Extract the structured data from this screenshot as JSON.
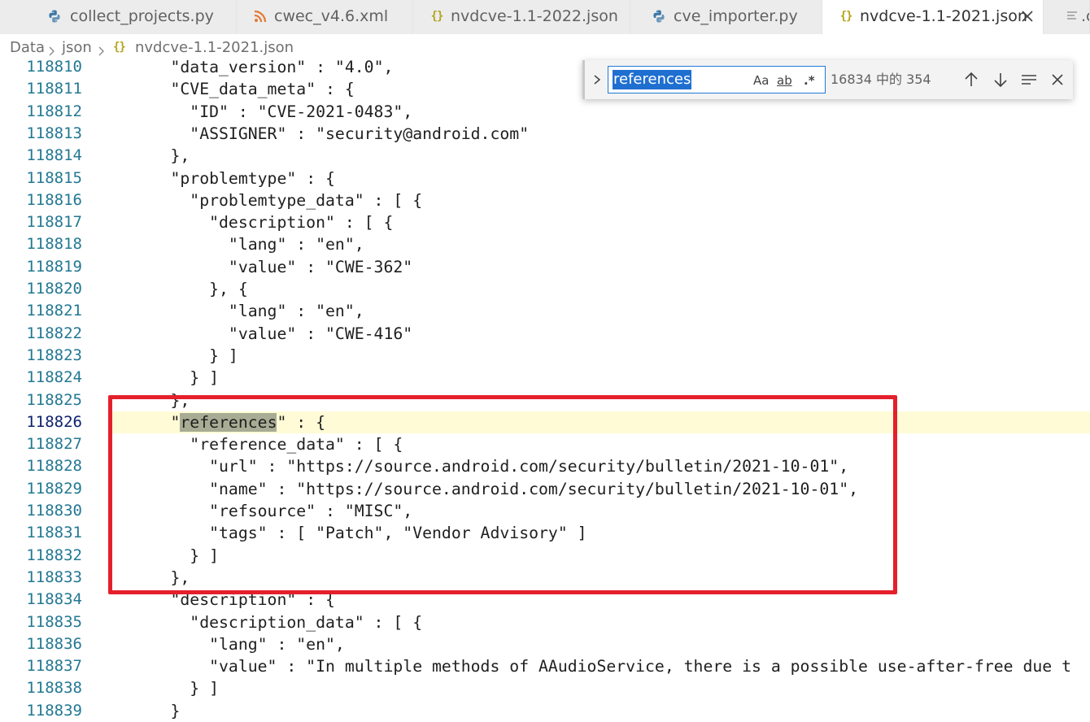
{
  "tabs": [
    {
      "label": "collect_projects.py",
      "icon": "python-icon",
      "active": false
    },
    {
      "label": "cwec_v4.6.xml",
      "icon": "rss-icon",
      "active": false
    },
    {
      "label": "nvdcve-1.1-2022.json",
      "icon": "json-icon",
      "active": false
    },
    {
      "label": "cve_importer.py",
      "icon": "python-icon",
      "active": false
    },
    {
      "label": "nvdcve-1.1-2021.json",
      "icon": "json-icon",
      "active": true
    },
    {
      "label": ".c",
      "icon": "file-lines-icon",
      "active": false
    }
  ],
  "json_glyph": "{}",
  "breadcrumb": {
    "folder": "Data",
    "subfolder": "json",
    "file": "nvdcve-1.1-2021.json"
  },
  "find": {
    "query": "references",
    "match_case": "Aa",
    "whole_word": "ab",
    "regex": ".*",
    "count": "16834 中的 354"
  },
  "editor": {
    "current_line": "118826",
    "lines": [
      {
        "n": "118810",
        "indent": "      ",
        "pre": "\"data_version\" : \"4.0\","
      },
      {
        "n": "118811",
        "indent": "      ",
        "pre": "\"CVE_data_meta\" : {"
      },
      {
        "n": "118812",
        "indent": "        ",
        "pre": "\"ID\" : \"CVE-2021-0483\","
      },
      {
        "n": "118813",
        "indent": "        ",
        "pre": "\"ASSIGNER\" : \"security@android.com\""
      },
      {
        "n": "118814",
        "indent": "      ",
        "pre": "},"
      },
      {
        "n": "118815",
        "indent": "      ",
        "pre": "\"problemtype\" : {"
      },
      {
        "n": "118816",
        "indent": "        ",
        "pre": "\"problemtype_data\" : [ {"
      },
      {
        "n": "118817",
        "indent": "          ",
        "pre": "\"description\" : [ {"
      },
      {
        "n": "118818",
        "indent": "            ",
        "pre": "\"lang\" : \"en\","
      },
      {
        "n": "118819",
        "indent": "            ",
        "pre": "\"value\" : \"CWE-362\""
      },
      {
        "n": "118820",
        "indent": "          ",
        "pre": "}, {"
      },
      {
        "n": "118821",
        "indent": "            ",
        "pre": "\"lang\" : \"en\","
      },
      {
        "n": "118822",
        "indent": "            ",
        "pre": "\"value\" : \"CWE-416\""
      },
      {
        "n": "118823",
        "indent": "          ",
        "pre": "} ]"
      },
      {
        "n": "118824",
        "indent": "        ",
        "pre": "} ]"
      },
      {
        "n": "118825",
        "indent": "      ",
        "pre": "},"
      },
      {
        "n": "118826",
        "indent": "      ",
        "pre": "\"",
        "hl": "references",
        "post": "\" : {"
      },
      {
        "n": "118827",
        "indent": "        ",
        "pre": "\"reference_data\" : [ {"
      },
      {
        "n": "118828",
        "indent": "          ",
        "pre": "\"url\" : \"https://source.android.com/security/bulletin/2021-10-01\","
      },
      {
        "n": "118829",
        "indent": "          ",
        "pre": "\"name\" : \"https://source.android.com/security/bulletin/2021-10-01\","
      },
      {
        "n": "118830",
        "indent": "          ",
        "pre": "\"refsource\" : \"MISC\","
      },
      {
        "n": "118831",
        "indent": "          ",
        "pre": "\"tags\" : [ \"Patch\", \"Vendor Advisory\" ]"
      },
      {
        "n": "118832",
        "indent": "        ",
        "pre": "} ]"
      },
      {
        "n": "118833",
        "indent": "      ",
        "pre": "},"
      },
      {
        "n": "118834",
        "indent": "      ",
        "pre": "\"description\" : {"
      },
      {
        "n": "118835",
        "indent": "        ",
        "pre": "\"description_data\" : [ {"
      },
      {
        "n": "118836",
        "indent": "          ",
        "pre": "\"lang\" : \"en\","
      },
      {
        "n": "118837",
        "indent": "          ",
        "pre": "\"value\" : \"In multiple methods of AAudioService, there is a possible use-after-free due t"
      },
      {
        "n": "118838",
        "indent": "        ",
        "pre": "} ]"
      },
      {
        "n": "118839",
        "indent": "      ",
        "pre": "}"
      }
    ]
  },
  "colors": {
    "line_number": "#237893",
    "find_match": "#a8ac94",
    "current_line": "#fffbd6",
    "annotation": "#e4202c",
    "json_icon": "#b5a41e",
    "python_icon": "#3b77a8",
    "rss_icon": "#e37933"
  }
}
